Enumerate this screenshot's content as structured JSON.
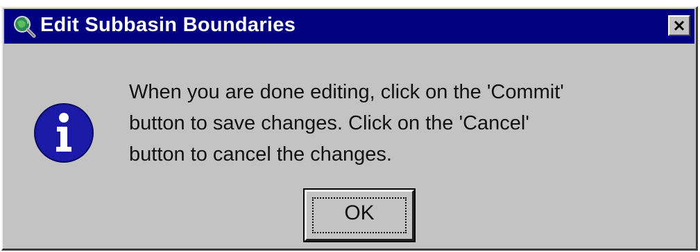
{
  "window": {
    "title": "Edit Subbasin Boundaries",
    "app_icon": "globe-magnifier-icon",
    "close_icon": "close-icon"
  },
  "dialog": {
    "icon": "information-icon",
    "message": "When you are done editing, click on the 'Commit'\nbutton to save changes.   Click on the 'Cancel'\nbutton to cancel the changes.",
    "ok_label": "OK"
  },
  "colors": {
    "titlebar": "#000080",
    "face": "#c3c3c3",
    "info_icon": "#1a1aa6"
  }
}
